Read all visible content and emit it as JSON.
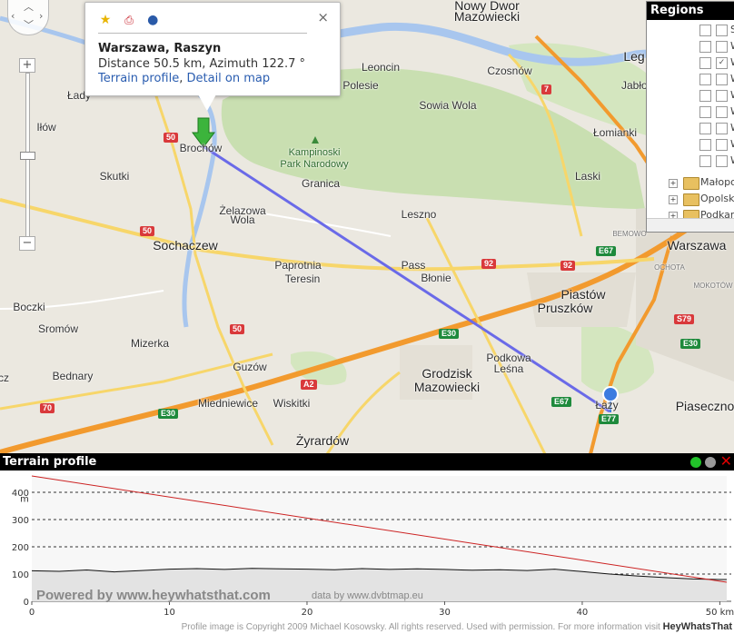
{
  "popup": {
    "icons": [
      "star-icon",
      "pdf-icon",
      "globe-icon"
    ],
    "title": "Warszawa, Raszyn",
    "distance": "Distance 50.5 km, Azimuth 122.7 °",
    "link_terrain": "Terrain profile",
    "link_sep": ",",
    "link_map": "Detail on map",
    "close": "×"
  },
  "regions": {
    "title": "Regions",
    "rows": [
      {
        "label": "S",
        "checked": false
      },
      {
        "label": "W",
        "checked": false
      },
      {
        "label": "W",
        "checked": true
      },
      {
        "label": "W",
        "checked": false
      },
      {
        "label": "W",
        "checked": false
      },
      {
        "label": "W",
        "checked": false
      },
      {
        "label": "W",
        "checked": false
      },
      {
        "label": "W",
        "checked": false
      },
      {
        "label": "W",
        "checked": false
      }
    ],
    "folders": [
      "Małopo",
      "Opolsk",
      "Podkar"
    ]
  },
  "map": {
    "labels": [
      {
        "text": "Nowy Dwor",
        "cls": "big"
      },
      {
        "text": "Mazowiecki",
        "cls": "big"
      },
      {
        "text": "Leg",
        "cls": "big"
      },
      {
        "text": "Leoncin",
        "cls": ""
      },
      {
        "text": "Czosnów",
        "cls": ""
      },
      {
        "text": "Jabłonn",
        "cls": ""
      },
      {
        "text": "Polesie",
        "cls": ""
      },
      {
        "text": "Łady",
        "cls": ""
      },
      {
        "text": "Sowia Wola",
        "cls": ""
      },
      {
        "text": "Iłów",
        "cls": ""
      },
      {
        "text": "Łomianki",
        "cls": ""
      },
      {
        "text": "Brochów",
        "cls": ""
      },
      {
        "text": "Kampinoski",
        "cls": "park"
      },
      {
        "text": "Park Narodowy",
        "cls": "park"
      },
      {
        "text": "Skutki",
        "cls": ""
      },
      {
        "text": "Granica",
        "cls": ""
      },
      {
        "text": "Laski",
        "cls": ""
      },
      {
        "text": "Żelazowa",
        "cls": ""
      },
      {
        "text": "Wola",
        "cls": ""
      },
      {
        "text": "Leszno",
        "cls": ""
      },
      {
        "text": "Sochaczew",
        "cls": "big"
      },
      {
        "text": "Warszawa",
        "cls": "big"
      },
      {
        "text": "Paprotnia",
        "cls": ""
      },
      {
        "text": "Pass",
        "cls": ""
      },
      {
        "text": "Teresin",
        "cls": ""
      },
      {
        "text": "Błonie",
        "cls": ""
      },
      {
        "text": "Piastów",
        "cls": "big"
      },
      {
        "text": "Pruszków",
        "cls": "big"
      },
      {
        "text": "Boczki",
        "cls": ""
      },
      {
        "text": "Sromów",
        "cls": ""
      },
      {
        "text": "Mizerka",
        "cls": ""
      },
      {
        "text": "Podkowa",
        "cls": ""
      },
      {
        "text": "Leśna",
        "cls": ""
      },
      {
        "text": "Bednary",
        "cls": ""
      },
      {
        "text": "Guzów",
        "cls": ""
      },
      {
        "text": "Grodzisk",
        "cls": "big"
      },
      {
        "text": "Mazowiecki",
        "cls": "big"
      },
      {
        "text": "Miedniewice",
        "cls": ""
      },
      {
        "text": "Wiskitki",
        "cls": ""
      },
      {
        "text": "Łazy",
        "cls": ""
      },
      {
        "text": "Piaseczno",
        "cls": "big"
      },
      {
        "text": "Żyrardów",
        "cls": "big"
      },
      {
        "text": "BEMOWO",
        "cls": ""
      },
      {
        "text": "OCHOTA",
        "cls": ""
      },
      {
        "text": "MOKOTÓW",
        "cls": ""
      },
      {
        "text": "cz",
        "cls": ""
      }
    ],
    "shields": [
      {
        "text": "50",
        "cls": "red"
      },
      {
        "text": "7",
        "cls": "red"
      },
      {
        "text": "50",
        "cls": "red"
      },
      {
        "text": "92",
        "cls": "red"
      },
      {
        "text": "92",
        "cls": "red"
      },
      {
        "text": "E67",
        "cls": "green"
      },
      {
        "text": "S79",
        "cls": "red"
      },
      {
        "text": "E30",
        "cls": "green"
      },
      {
        "text": "E30",
        "cls": "green"
      },
      {
        "text": "50",
        "cls": "red"
      },
      {
        "text": "A2",
        "cls": "red"
      },
      {
        "text": "E67",
        "cls": "green"
      },
      {
        "text": "70",
        "cls": "red"
      },
      {
        "text": "E30",
        "cls": "green"
      },
      {
        "text": "E77",
        "cls": "green"
      }
    ]
  },
  "terrain": {
    "title": "Terrain profile",
    "close": "✕",
    "y_unit": "m",
    "y_ticks": [
      "400",
      "300",
      "200",
      "100",
      "0"
    ],
    "x_ticks": [
      "0",
      "10",
      "20",
      "30",
      "40",
      "50 km"
    ],
    "powered": "Powered by www.heywhatsthat.com",
    "data_by": "data by www.dvbtmap.eu",
    "profile_km": [
      0,
      2,
      4,
      6,
      8,
      10,
      12,
      14,
      16,
      18,
      20,
      22,
      24,
      26,
      28,
      30,
      32,
      34,
      36,
      38,
      40,
      42,
      44,
      46,
      48,
      50,
      50.5
    ],
    "profile_m": [
      112,
      110,
      115,
      108,
      113,
      118,
      120,
      117,
      121,
      119,
      118,
      116,
      120,
      117,
      119,
      117,
      114,
      116,
      113,
      118,
      109,
      100,
      93,
      87,
      82,
      80,
      80
    ],
    "los_start_m": 460,
    "los_end_m": 70
  },
  "credit": {
    "text": "Profile image is Copyright 2009 Michael Kosowsky. All rights reserved. Used with permission. For more information visit ",
    "brand": "HeyWhatsThat"
  }
}
